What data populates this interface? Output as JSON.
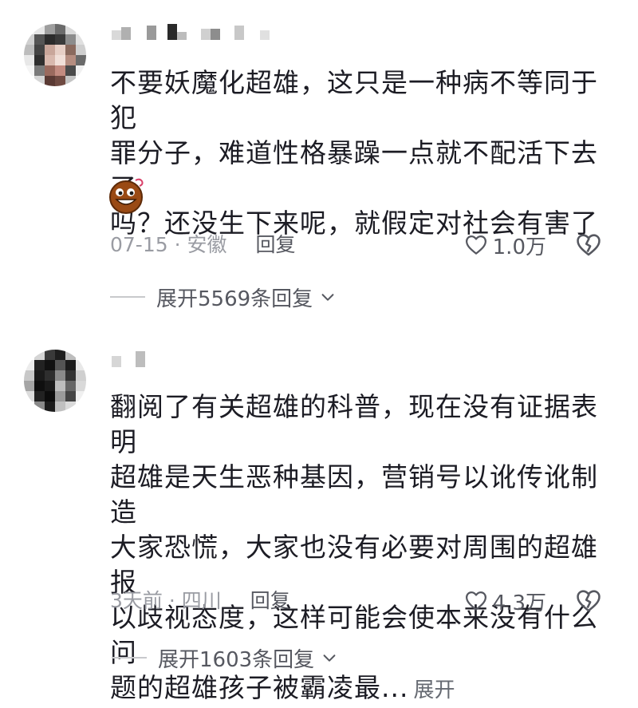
{
  "comments": [
    {
      "text": "不要妖魔化超雄，这只是一种病不等同于犯\n罪分子，难道性格暴躁一点就不配活下去了\n吗？还没生下来呢，就假定对社会有害了",
      "emoji": "smiling-face-emoji",
      "date": "07-15",
      "separator": "·",
      "location": "安徽",
      "reply_label": "回复",
      "likes": "1.0万",
      "replies_label": "展开5569条回复"
    },
    {
      "text": "翻阅了有关超雄的科普，现在没有证据表明\n超雄是天生恶种基因，营销号以讹传讹制造\n大家恐慌，大家也没有必要对周围的超雄报\n以歧视态度，这样可能会使本来没有什么问\n题的超雄孩子被霸凌最...",
      "expand_label": "展开",
      "date": "3天前",
      "separator": "·",
      "location": "四川",
      "reply_label": "回复",
      "likes": "4.3万",
      "replies_label": "展开1603条回复"
    }
  ],
  "colors": {
    "text": "#1c1c24",
    "meta": "#9a9ca3",
    "secondary": "#565860"
  },
  "icons": [
    "heart-icon",
    "broken-heart-icon",
    "chevron-down-icon"
  ]
}
